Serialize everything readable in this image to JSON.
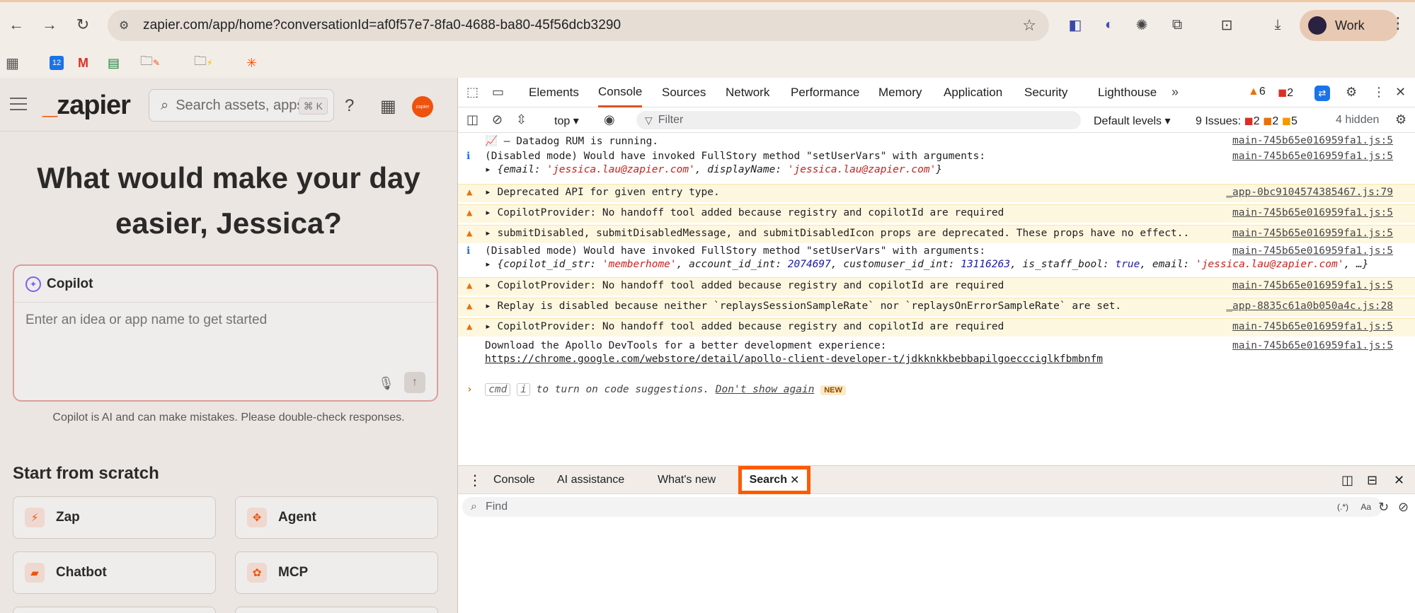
{
  "browser": {
    "url": "zapier.com/app/home?conversationId=af0f57e7-8fa0-4688-ba80-45f56dcb3290",
    "profile_label": "Work",
    "calendar_day": "12"
  },
  "app": {
    "logo_text": "zapier",
    "search_placeholder": "Search assets, apps",
    "search_shortcut": "⌘ K",
    "hero_line1": "What would make your day",
    "hero_line2": "easier, Jessica?",
    "copilot_title": "Copilot",
    "copilot_placeholder": "Enter an idea or app name to get started",
    "disclaimer": "Copilot is AI and can make mistakes. Please double-check responses.",
    "scratch_title": "Start from scratch",
    "tiles": [
      "Zap",
      "Agent",
      "Chatbot",
      "MCP"
    ],
    "badge_text": "zapier"
  },
  "devtools": {
    "tabs": [
      "Elements",
      "Console",
      "Sources",
      "Network",
      "Performance",
      "Memory",
      "Application",
      "Security",
      "Lighthouse"
    ],
    "warn_count": "6",
    "error_count": "2",
    "context": "top",
    "filter_placeholder": "Filter",
    "levels": "Default levels",
    "issues_label": "9 Issues:",
    "issues_err": "2",
    "issues_warn": "2",
    "issues_info": "5",
    "hidden": "4 hidden",
    "console": {
      "r1": "📈 – Datadog RUM is running.",
      "r1_src": "main-745b65e016959fa1.js:5",
      "r2": "(Disabled mode) Would have invoked FullStory method \"setUserVars\" with arguments:",
      "r2_src": "main-745b65e016959fa1.js:5",
      "r2_detail_a": "▸ {email: ",
      "r2_email": "'jessica.lau@zapier.com'",
      "r2_detail_b": ", displayName: ",
      "r2_name": "'jessica.lau@zapier.com'",
      "r2_detail_c": "}",
      "r3": "▸ Deprecated API for given entry type.",
      "r3_src": "_app-0bc9104574385467.js:79",
      "r4": "▸ CopilotProvider: No handoff tool added because registry and copilotId are required",
      "r4_src": "main-745b65e016959fa1.js:5",
      "r5": "▸ submitDisabled, submitDisabledMessage, and submitDisabledIcon props are deprecated. These props have no effect..",
      "r5_src": "main-745b65e016959fa1.js:5",
      "r6": "(Disabled mode) Would have invoked FullStory method \"setUserVars\" with arguments:",
      "r6_src": "main-745b65e016959fa1.js:5",
      "r6_k1": "▸ {copilot_id_str: ",
      "r6_v1": "'memberhome'",
      "r6_k2": ", account_id_int: ",
      "r6_v2": "2074697",
      "r6_k3": ", customuser_id_int: ",
      "r6_v3": "13116263",
      "r6_k4": ", is_staff_bool: ",
      "r6_v4": "true",
      "r6_k5": ", email: ",
      "r6_v5": "'jessica.lau@zapier.com'",
      "r6_k6": ", …}",
      "r7": "▸ CopilotProvider: No handoff tool added because registry and copilotId are required",
      "r7_src": "main-745b65e016959fa1.js:5",
      "r8": "▸ Replay is disabled because neither `replaysSessionSampleRate` nor `replaysOnErrorSampleRate` are set.",
      "r8_src": "_app-8835c61a0b050a4c.js:28",
      "r9": "▸ CopilotProvider: No handoff tool added because registry and copilotId are required",
      "r9_src": "main-745b65e016959fa1.js:5",
      "r10": "Download the Apollo DevTools for a better development experience:",
      "r10_src": "main-745b65e016959fa1.js:5",
      "r10_link": "https://chrome.google.com/webstore/detail/apollo-client-developer-t/jdkknkkbebbapilgoeccciglkfbmbnfm",
      "hint_cmd": "cmd",
      "hint_i": "i",
      "hint_text": " to turn on code suggestions. ",
      "hint_link": "Don't show again",
      "hint_new": "NEW"
    },
    "drawer_tabs": [
      "Console",
      "AI assistance",
      "What's new"
    ],
    "drawer_active": "Search",
    "find_placeholder": "Find",
    "regex_label": "(.*)",
    "case_label": "Aa"
  }
}
